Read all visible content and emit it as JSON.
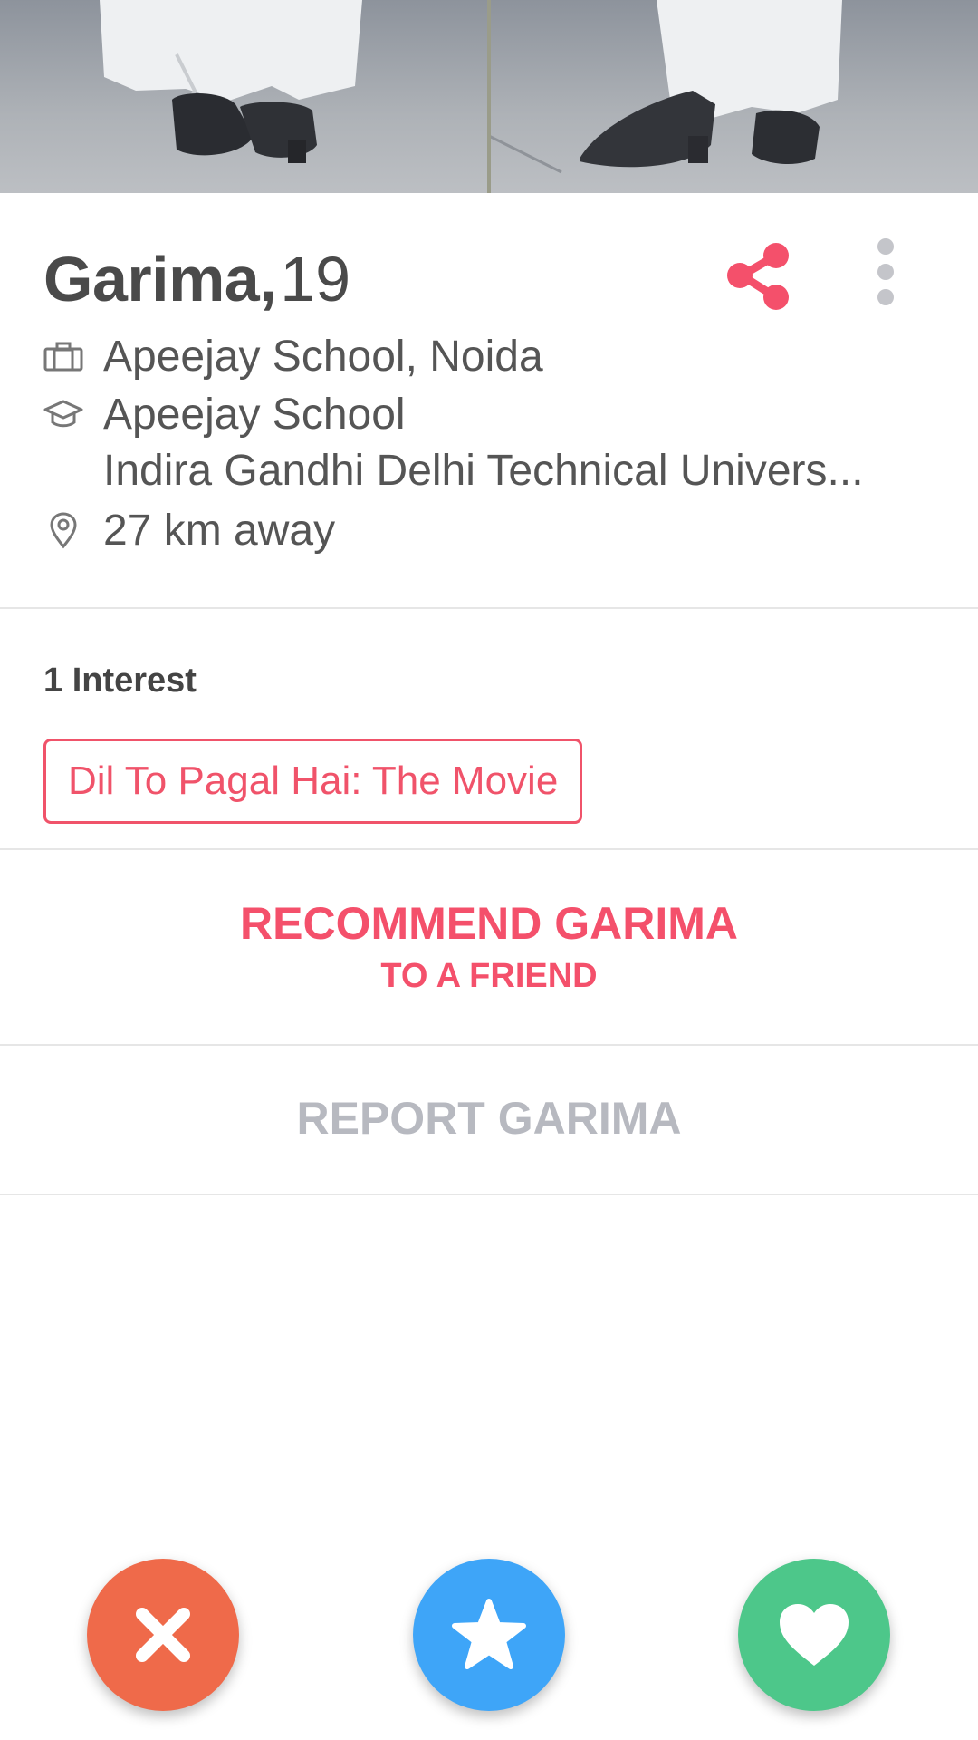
{
  "profile": {
    "name": "Garima,",
    "age": "19",
    "job": "Apeejay School, Noida",
    "school_1": "Apeejay School",
    "school_2": "Indira Gandhi Delhi Technical Univers...",
    "distance": "27 km away"
  },
  "interests": {
    "title": "1 Interest",
    "items": [
      "Dil To Pagal Hai: The Movie"
    ]
  },
  "actions": {
    "recommend_line1": "RECOMMEND GARIMA",
    "recommend_line2": "TO A FRIEND",
    "report": "REPORT GARIMA"
  },
  "icons": {
    "share": "share-icon",
    "more": "more-vertical-icon",
    "job": "briefcase-icon",
    "school": "graduation-cap-icon",
    "location": "location-pin-icon",
    "nope": "close-icon",
    "superlike": "star-icon",
    "like": "heart-icon"
  },
  "colors": {
    "accent": "#f4506b",
    "nope": "#ef6a4a",
    "superlike": "#3ea5f8",
    "like": "#4dc78a",
    "muted": "#b7b9c0"
  }
}
